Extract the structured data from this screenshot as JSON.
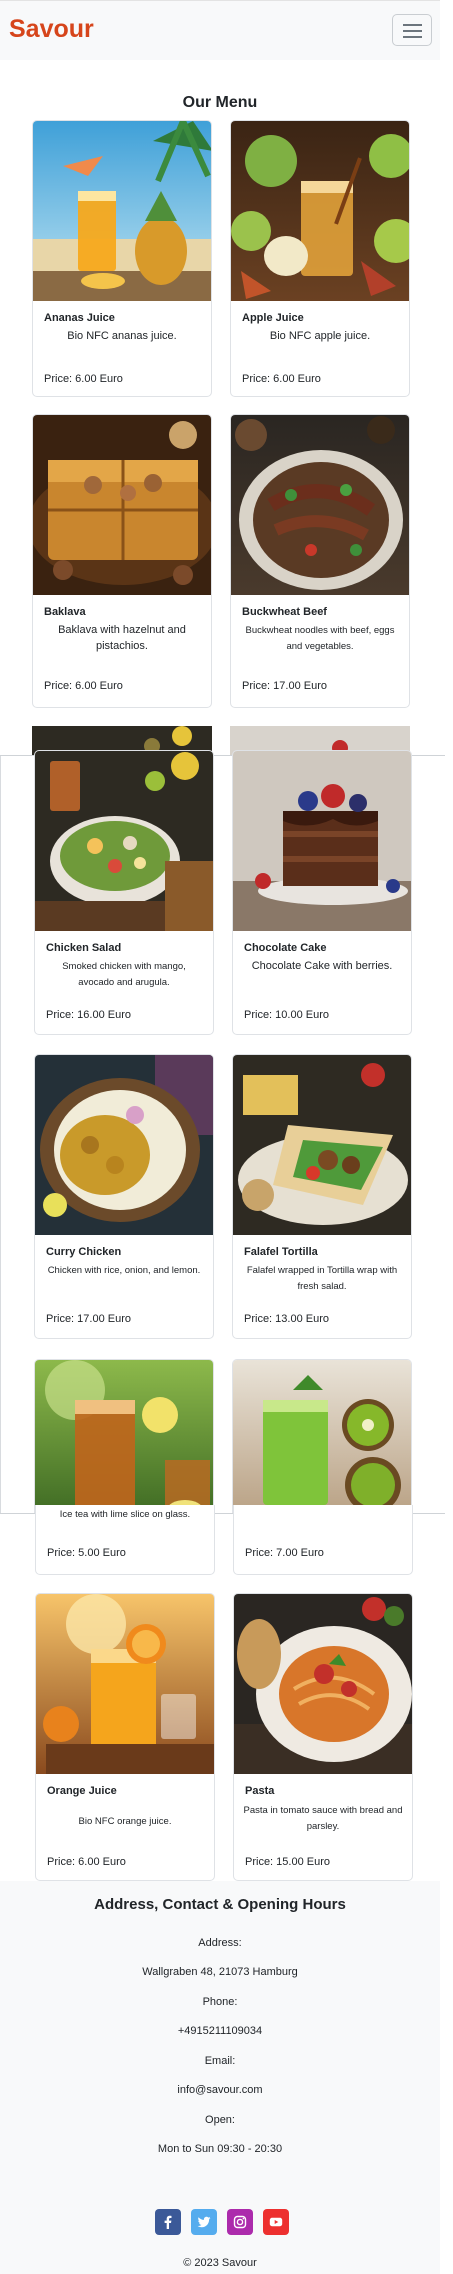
{
  "brand": "Savour",
  "menu_heading": "Our Menu",
  "items": [
    {
      "title": "Ananas Juice",
      "description": "Bio NFC ananas juice.",
      "price": "Price: 6.00 Euro"
    },
    {
      "title": "Apple Juice",
      "description": "Bio NFC apple juice.",
      "price": "Price: 6.00 Euro"
    },
    {
      "title": "Baklava",
      "description": "Baklava with hazelnut and pistachios.",
      "price": "Price: 6.00 Euro"
    },
    {
      "title": "Buckwheat Beef",
      "description": "Buckwheat noodles with beef, eggs and vegetables.",
      "price": "Price: 17.00 Euro"
    },
    {
      "title": "Chicken Salad",
      "description": "Smoked chicken with mango, avocado and arugula.",
      "price": "Price: 16.00 Euro"
    },
    {
      "title": "Chocolate Cake",
      "description": "Chocolate Cake with berries.",
      "price": "Price: 10.00 Euro"
    },
    {
      "title": "Curry Chicken",
      "description": "Chicken with rice, onion, and lemon.",
      "price": "Price: 17.00 Euro"
    },
    {
      "title": "Falafel Tortilla",
      "description": "Falafel wrapped in Tortilla wrap with fresh salad.",
      "price": "Price: 13.00 Euro"
    },
    {
      "title": "",
      "description": "Ice tea with lime slice on glass.",
      "price": "Price: 5.00 Euro"
    },
    {
      "title": "",
      "description": "",
      "price": "Price: 7.00 Euro"
    },
    {
      "title": "Orange Juice",
      "description": "Bio NFC orange juice.",
      "price": "Price: 6.00 Euro"
    },
    {
      "title": "Pasta",
      "description": "Pasta in tomato sauce with bread and parsley.",
      "price": "Price: 15.00 Euro"
    }
  ],
  "footer": {
    "heading": "Address, Contact & Opening Hours",
    "address_label": "Address:",
    "address": "Wallgraben 48, 21073 Hamburg",
    "phone_label": "Phone:",
    "phone": "+4915211109034",
    "email_label": "Email:",
    "email": "info@savour.com",
    "open_label": "Open:",
    "hours": "Mon to Sun 09:30 - 20:30",
    "copyright": "© 2023 Savour"
  },
  "social": [
    {
      "icon": "facebook-icon",
      "color": "#3b5998"
    },
    {
      "icon": "twitter-icon",
      "color": "#55acee"
    },
    {
      "icon": "instagram-icon",
      "color": "#ac2bac"
    },
    {
      "icon": "youtube-icon",
      "color": "#ed302f"
    }
  ],
  "colors": {
    "brand": "#d6451b",
    "navbar_bg": "#f8f9fa",
    "footer_bg": "#f8f9fa"
  }
}
